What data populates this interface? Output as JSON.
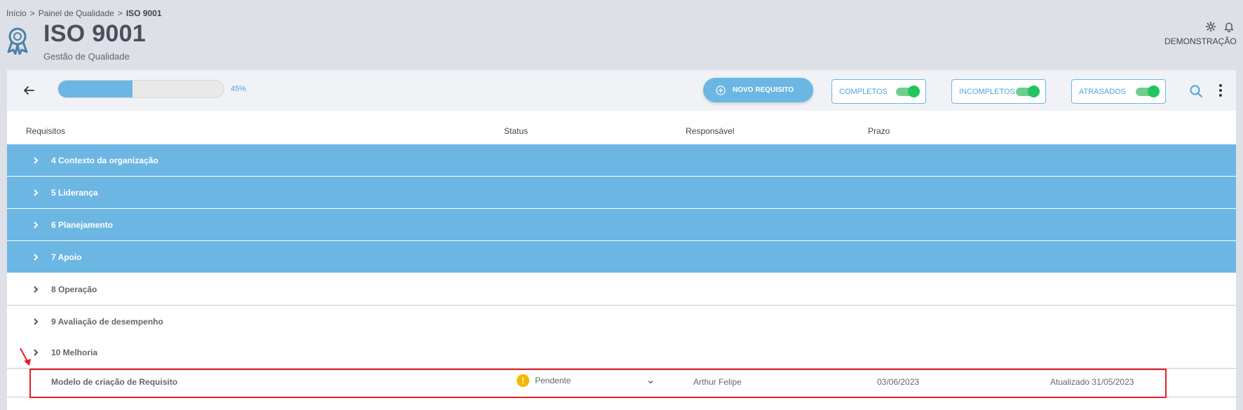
{
  "breadcrumb": {
    "items": [
      "Início",
      "Painel de Qualidade"
    ],
    "separator": ">",
    "current": "ISO 9001"
  },
  "header": {
    "title": "ISO 9001",
    "subtitle": "Gestão de Qualidade",
    "icon": "award-icon"
  },
  "user": {
    "name": "DEMONSTRAÇÃO"
  },
  "progress": {
    "value_percent": 45,
    "label": "45%"
  },
  "toolbar": {
    "new_button": "NOVO REQUISITO",
    "filters": [
      {
        "label": "COMPLETOS",
        "on": true
      },
      {
        "label": "INCOMPLETOS",
        "on": true
      },
      {
        "label": "ATRASADOS",
        "on": true
      }
    ]
  },
  "columns": [
    "Requisitos",
    "Status",
    "Responsável",
    "Prazo"
  ],
  "groups": [
    {
      "label": "4 Contexto da organização",
      "style": "blue"
    },
    {
      "label": "5 Liderança",
      "style": "blue"
    },
    {
      "label": "6 Planejamento",
      "style": "blue"
    },
    {
      "label": "7 Apoio",
      "style": "blue"
    },
    {
      "label": "8 Operação",
      "style": "white"
    },
    {
      "label": "9 Avaliação de desempenho",
      "style": "white"
    },
    {
      "label": "10 Melhoria",
      "style": "white"
    }
  ],
  "requirement": {
    "name": "Modelo de criação de Requisito",
    "status": "Pendente",
    "status_icon": "!",
    "responsible": "Arthur Felipe",
    "deadline": "03/06/2023",
    "updated": "Atualizado 31/05/2023"
  },
  "colors": {
    "accent": "#6cb6e4",
    "toggle_on": "#22c55e",
    "warning": "#f5b700",
    "highlight": "#e41e26"
  }
}
